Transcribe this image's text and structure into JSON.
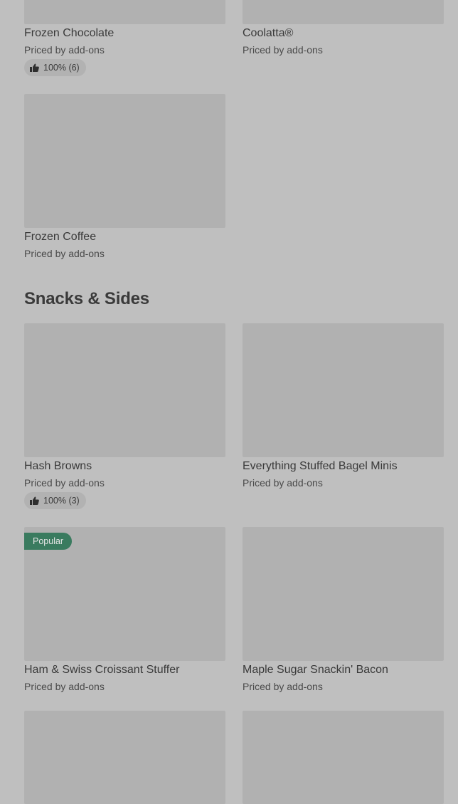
{
  "items": {
    "frozen_chocolate": {
      "title": "Frozen Chocolate",
      "price": "Priced by add-ons",
      "rating": "100% (6)"
    },
    "coolatta": {
      "title": "Coolatta®",
      "price": "Priced by add-ons"
    },
    "frozen_coffee": {
      "title": "Frozen Coffee",
      "price": "Priced by add-ons"
    },
    "hash_browns": {
      "title": "Hash Browns",
      "price": "Priced by add-ons",
      "rating": "100% (3)"
    },
    "bagel_minis": {
      "title": "Everything Stuffed Bagel Minis",
      "price": "Priced by add-ons"
    },
    "ham_swiss": {
      "title": "Ham & Swiss Croissant Stuffer",
      "price": "Priced by add-ons",
      "badge": "Popular"
    },
    "maple_bacon": {
      "title": "Maple Sugar Snackin' Bacon",
      "price": "Priced by add-ons"
    }
  },
  "sections": {
    "snacks_sides": {
      "title": "Snacks & Sides"
    }
  },
  "icons": {
    "rating": "thumbs-up-icon"
  },
  "colors": {
    "page_background": "#bfbfbf",
    "image_placeholder": "#b1b1b1",
    "popular_badge": "#3a7b5f"
  }
}
